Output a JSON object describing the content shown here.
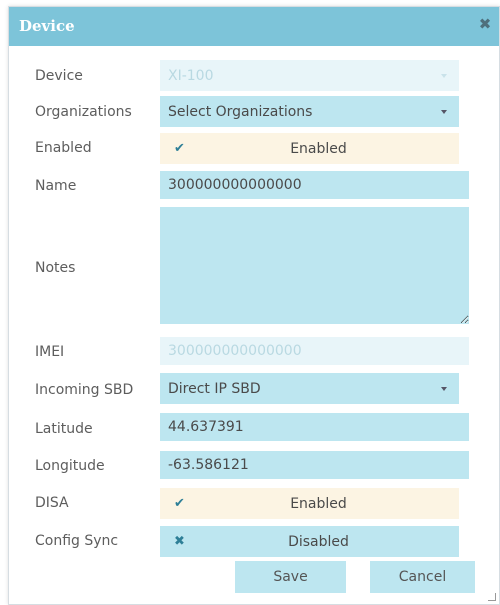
{
  "dialog": {
    "title": "Device",
    "close_glyph": "✖"
  },
  "fields": {
    "device": {
      "label": "Device",
      "value": "XI-100"
    },
    "organizations": {
      "label": "Organizations",
      "value": "Select Organizations"
    },
    "enabled": {
      "label": "Enabled",
      "state": "Enabled",
      "mark": "✔"
    },
    "name": {
      "label": "Name",
      "value": "300000000000000"
    },
    "notes": {
      "label": "Notes",
      "value": ""
    },
    "imei": {
      "label": "IMEI",
      "value": "300000000000000"
    },
    "incoming_sbd": {
      "label": "Incoming SBD",
      "value": "Direct IP SBD"
    },
    "latitude": {
      "label": "Latitude",
      "value": "44.637391"
    },
    "longitude": {
      "label": "Longitude",
      "value": "-63.586121"
    },
    "disa": {
      "label": "DISA",
      "state": "Enabled",
      "mark": "✔"
    },
    "config_sync": {
      "label": "Config Sync",
      "state": "Disabled",
      "mark": "✖"
    }
  },
  "buttons": {
    "save": "Save",
    "cancel": "Cancel"
  },
  "colors": {
    "titlebar": "#7dc4d9",
    "field": "#bde6f0",
    "field_disabled": "#e8f5f9",
    "toggle_on": "#fcf4e3"
  }
}
